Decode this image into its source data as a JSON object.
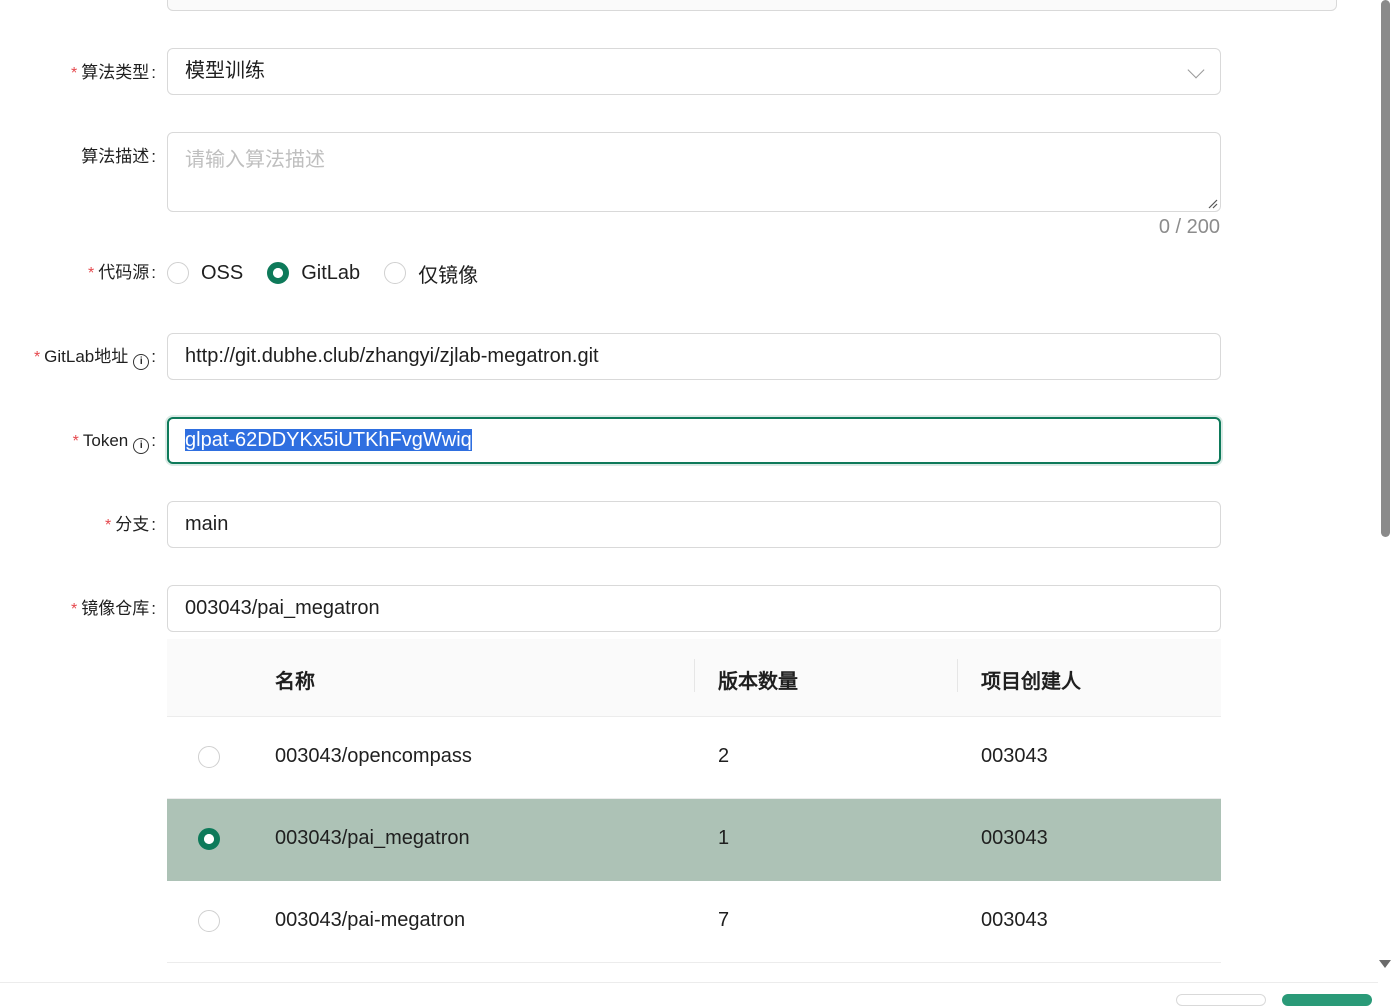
{
  "form": {
    "algo_type": {
      "label": "算法类型",
      "value": "模型训练"
    },
    "algo_desc": {
      "label": "算法描述",
      "placeholder": "请输入算法描述",
      "counter": "0 / 200"
    },
    "code_source": {
      "label": "代码源",
      "options": [
        "OSS",
        "GitLab",
        "仅镜像"
      ],
      "selected": "GitLab"
    },
    "gitlab_url": {
      "label": "GitLab地址",
      "value": "http://git.dubhe.club/zhangyi/zjlab-megatron.git"
    },
    "token": {
      "label": "Token",
      "value": "glpat-62DDYKx5iUTKhFvgWwiq"
    },
    "branch": {
      "label": "分支",
      "value": "main"
    },
    "image_repo": {
      "label": "镜像仓库",
      "value": "003043/pai_megatron"
    }
  },
  "table": {
    "headers": [
      "名称",
      "版本数量",
      "项目创建人"
    ],
    "rows": [
      {
        "name": "003043/opencompass",
        "versions": "2",
        "creator": "003043",
        "selected": false
      },
      {
        "name": "003043/pai_megatron",
        "versions": "1",
        "creator": "003043",
        "selected": true
      },
      {
        "name": "003043/pai-megatron",
        "versions": "7",
        "creator": "003043",
        "selected": false
      }
    ]
  },
  "colors": {
    "accent": "#0e7a5a",
    "selected_row": "#adc2b6",
    "required": "#e5484d"
  },
  "icons": {
    "info": "info-circle-icon",
    "dropdown": "chevron-down-icon"
  }
}
